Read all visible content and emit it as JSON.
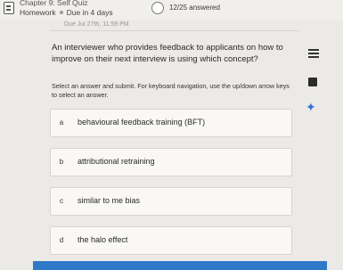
{
  "header": {
    "chapter": "Chapter 9: Self Quiz",
    "type": "Homework",
    "due_short": "Due in 4 days",
    "answered": "12/25 answered",
    "due_full": "Due Jul 27th, 11:59 PM"
  },
  "question": {
    "text": "An interviewer who provides feedback to applicants on how to improve on their next interview is using which concept?",
    "instruction": "Select an answer and submit. For keyboard navigation, use the up/down arrow keys to select an answer."
  },
  "options": [
    {
      "letter": "a",
      "text": "behavioural feedback training (BFT)"
    },
    {
      "letter": "b",
      "text": "attributional retraining"
    },
    {
      "letter": "c",
      "text": "similar to me bias"
    },
    {
      "letter": "d",
      "text": "the halo effect"
    }
  ],
  "icons": {
    "document": "document-icon",
    "progress": "progress-ring-icon",
    "list": "list-icon",
    "flag": "flag-icon",
    "sparkle": "sparkle-icon"
  },
  "colors": {
    "accent": "#2f79c9",
    "sparkle": "#3b6fd8"
  }
}
